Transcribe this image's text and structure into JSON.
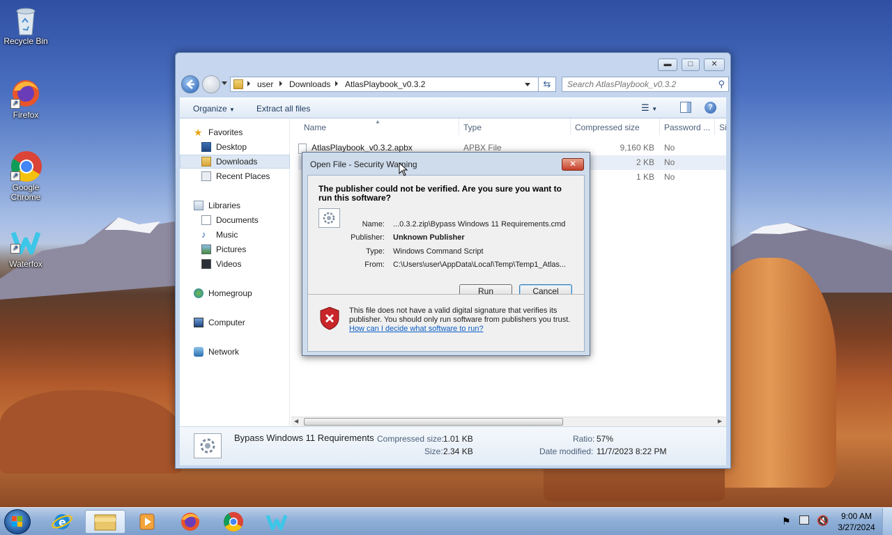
{
  "desktop": {
    "icons": [
      {
        "label": "Recycle Bin"
      },
      {
        "label": "Firefox"
      },
      {
        "label": "Google Chrome"
      },
      {
        "label": "Waterfox"
      }
    ]
  },
  "explorer": {
    "breadcrumb": [
      "user",
      "Downloads",
      "AtlasPlaybook_v0.3.2"
    ],
    "search_placeholder": "Search AtlasPlaybook_v0.3.2",
    "toolbar": {
      "organize": "Organize",
      "extract": "Extract all files"
    },
    "nav": {
      "favorites": "Favorites",
      "desktop": "Desktop",
      "downloads": "Downloads",
      "recent": "Recent Places",
      "libraries": "Libraries",
      "documents": "Documents",
      "music": "Music",
      "pictures": "Pictures",
      "videos": "Videos",
      "homegroup": "Homegroup",
      "computer": "Computer",
      "network": "Network"
    },
    "columns": {
      "name": "Name",
      "type": "Type",
      "compressed": "Compressed size",
      "password": "Password ...",
      "size": "Si"
    },
    "files": [
      {
        "name": "AtlasPlaybook_v0.3.2.apbx",
        "type": "APBX File",
        "compressed": "9,160 KB",
        "password": "No"
      },
      {
        "name": "",
        "type": "",
        "compressed": "2 KB",
        "password": "No"
      },
      {
        "name": "",
        "type": "",
        "compressed": "1 KB",
        "password": "No"
      }
    ],
    "details": {
      "filename": "Bypass Windows 11 Requirements",
      "compressed_label": "Compressed size:",
      "compressed_value": "1.01 KB",
      "size_label": "Size:",
      "size_value": "2.34 KB",
      "ratio_label": "Ratio:",
      "ratio_value": "57%",
      "modified_label": "Date modified:",
      "modified_value": "11/7/2023 8:22 PM"
    }
  },
  "dialog": {
    "title": "Open File - Security Warning",
    "question": "The publisher could not be verified.  Are you sure you want to run this software?",
    "name_label": "Name:",
    "name_value": "...0.3.2.zip\\Bypass Windows 11 Requirements.cmd",
    "publisher_label": "Publisher:",
    "publisher_value": "Unknown Publisher",
    "type_label": "Type:",
    "type_value": "Windows Command Script",
    "from_label": "From:",
    "from_value": "C:\\Users\\user\\AppData\\Local\\Temp\\Temp1_Atlas...",
    "run": "Run",
    "cancel": "Cancel",
    "warning_text": "This file does not have a valid digital signature that verifies its publisher.  You should only run software from publishers you trust.",
    "help_link": "How can I decide what software to run?"
  },
  "taskbar": {
    "time": "9:00 AM",
    "date": "3/27/2024"
  },
  "colors": {
    "accent": "#3a6fb5",
    "link": "#0a5ec7",
    "close_red": "#c7402a"
  }
}
